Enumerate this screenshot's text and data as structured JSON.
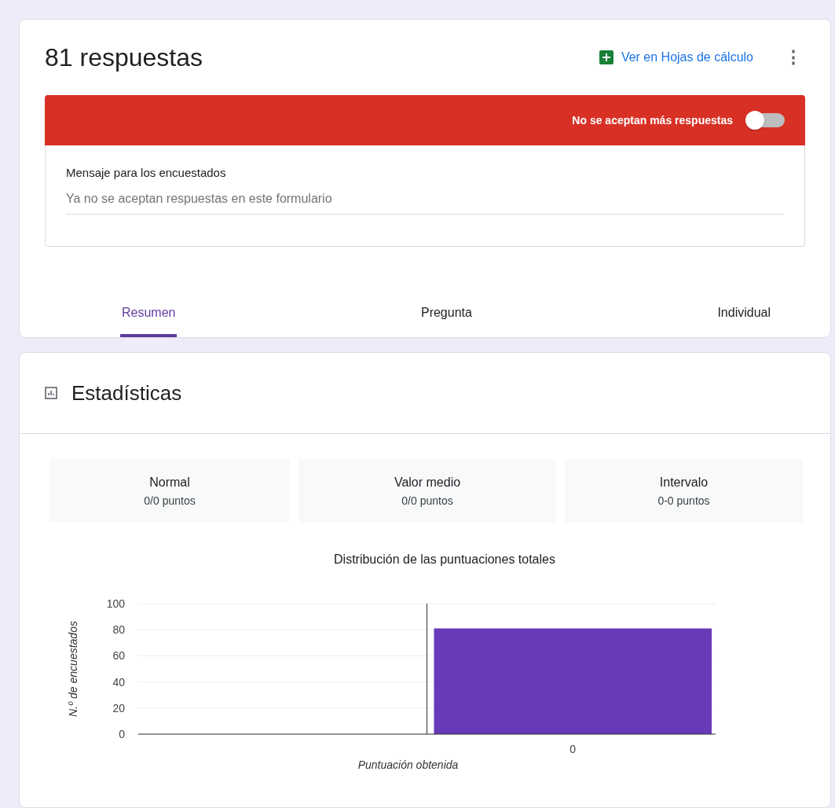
{
  "header": {
    "title": "81 respuestas",
    "sheets_link": "Ver en Hojas de cálculo",
    "more_menu": "⋮"
  },
  "banner": {
    "label": "No se aceptan más respuestas",
    "on": false
  },
  "message": {
    "label": "Mensaje para los encuestados",
    "placeholder": "Ya no se aceptan respuestas en este formulario"
  },
  "tabs": [
    {
      "label": "Resumen",
      "selected": true
    },
    {
      "label": "Pregunta",
      "selected": false
    },
    {
      "label": "Individual",
      "selected": false
    }
  ],
  "stats": {
    "title": "Estadísticas",
    "cards": [
      {
        "label": "Normal",
        "value": "0/0 puntos"
      },
      {
        "label": "Valor medio",
        "value": "0/0 puntos"
      },
      {
        "label": "Intervalo",
        "value": "0-0 puntos"
      }
    ],
    "chart_data": {
      "type": "bar",
      "title": "Distribución de las puntuaciones totales",
      "xlabel": "Puntuación obtenida",
      "ylabel": "N.º de encuestados",
      "categories": [
        "0"
      ],
      "series": [
        {
          "color": "#673ab7",
          "values": [
            81
          ]
        }
      ],
      "grid": true,
      "ylim": [
        0,
        100
      ],
      "yticks": [
        0,
        20,
        40,
        60,
        80,
        100
      ]
    }
  }
}
